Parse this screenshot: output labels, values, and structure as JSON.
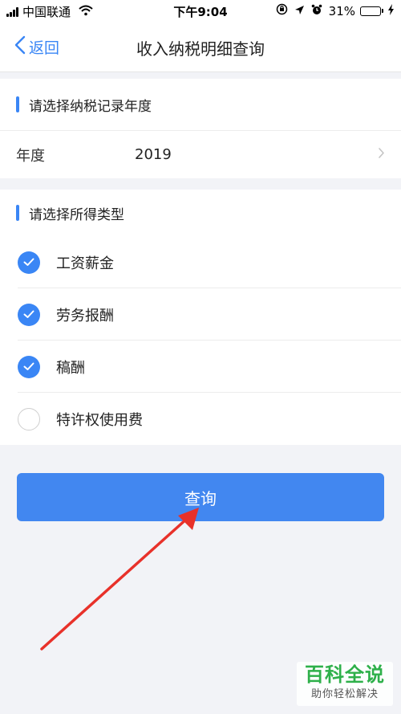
{
  "status_bar": {
    "carrier": "中国联通",
    "time": "下午9:04",
    "battery_percent": "31%",
    "battery_level": 0.31
  },
  "nav": {
    "back_label": "返回",
    "title": "收入纳税明细查询"
  },
  "year_section": {
    "title": "请选择纳税记录年度",
    "year_label": "年度",
    "year_value": "2019"
  },
  "type_section": {
    "title": "请选择所得类型",
    "options": [
      {
        "label": "工资薪金",
        "checked": true
      },
      {
        "label": "劳务报酬",
        "checked": true
      },
      {
        "label": "稿酬",
        "checked": true
      },
      {
        "label": "特许权使用费",
        "checked": false
      }
    ]
  },
  "query_button": "查询",
  "watermark": {
    "main": "百科全说",
    "sub": "助你轻松解决"
  },
  "colors": {
    "accent": "#3a86f5",
    "button": "#4287f0",
    "background": "#f2f3f7",
    "annotation_arrow": "#e8312a",
    "watermark_green": "#2eb04a"
  }
}
